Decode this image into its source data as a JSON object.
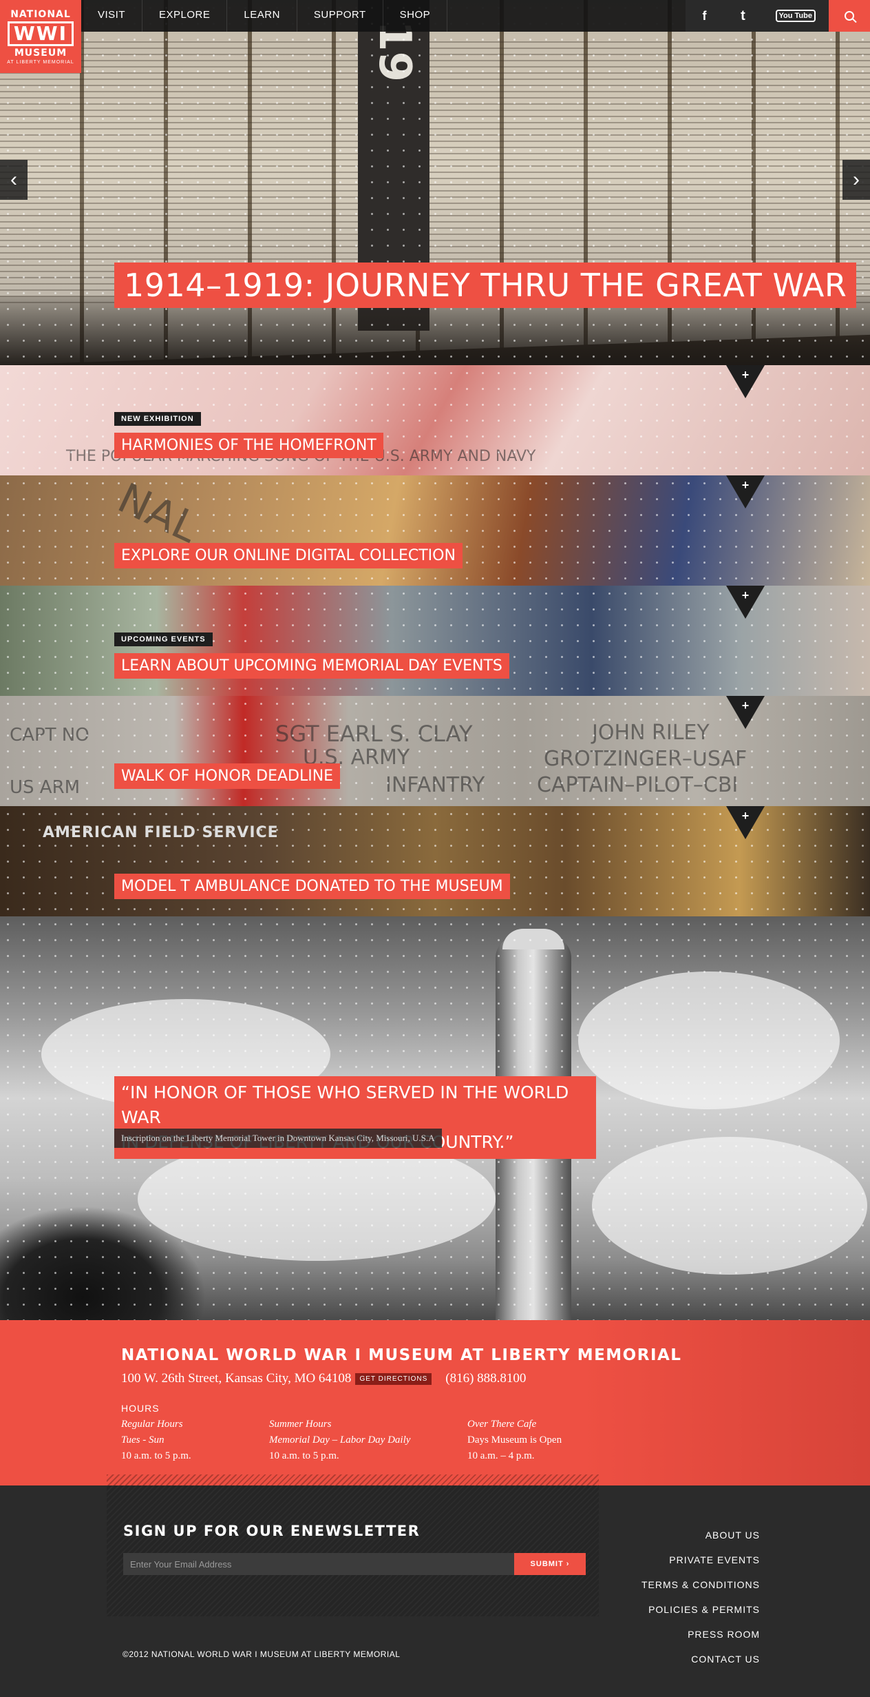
{
  "logo": {
    "line1": "NATIONAL",
    "line2": "WWI",
    "line3": "MUSEUM",
    "line4": "AT LIBERTY MEMORIAL"
  },
  "nav": {
    "items": [
      "VISIT",
      "EXPLORE",
      "LEARN",
      "SUPPORT",
      "SHOP"
    ]
  },
  "social": {
    "facebook": "f",
    "twitter": "t",
    "youtube": "You Tube"
  },
  "icons": {
    "search": "search-icon",
    "facebook": "facebook-icon",
    "twitter": "twitter-icon",
    "youtube": "youtube-icon",
    "prev": "chevron-left-icon",
    "next": "chevron-right-icon",
    "expand": "plus-icon"
  },
  "hero": {
    "title": "1914–1919: JOURNEY THRU THE GREAT WAR",
    "year_text": "19",
    "prev_arrow": "‹",
    "next_arrow": "›"
  },
  "features": [
    {
      "tag": "NEW EXHIBITION",
      "label": "HARMONIES OF THE HOMEFRONT"
    },
    {
      "tag": "",
      "label": "EXPLORE OUR ONLINE DIGITAL COLLECTION"
    },
    {
      "tag": "UPCOMING EVENTS",
      "label": "LEARN ABOUT UPCOMING MEMORIAL DAY EVENTS"
    },
    {
      "tag": "",
      "label": "WALK OF HONOR DEADLINE"
    },
    {
      "tag": "",
      "label": "MODEL T AMBULANCE DONATED TO THE MUSEUM"
    }
  ],
  "feature_art": {
    "s1": "THE POPULAR MARCHING SONG OF THE U.S. ARMY AND NAVY",
    "s2": "NAL",
    "s4a": "CAPT NO",
    "s4b": "SGT EARL S. CLAY",
    "s4c": "U.S. ARMY",
    "s4d": "INFANTRY",
    "s4e": "JOHN RILEY",
    "s4f": "GROTZINGER–USAF",
    "s4g": "CAPTAIN–PILOT–CBI",
    "s4h": "US ARM",
    "s5": "AMERICAN FIELD SERVICE"
  },
  "toggle_symbol": "+",
  "quote": {
    "text_line1": "“IN HONOR OF THOSE WHO SERVED IN THE WORLD WAR",
    "text_line2": "IN DEFENSE OF LIBERTY AND OUR COUNTRY.”",
    "cite": "Inscription on the Liberty Memorial Tower in Downtown Kansas City, Missouri, U.S.A"
  },
  "info": {
    "name": "NATIONAL WORLD WAR I MUSEUM AT LIBERTY MEMORIAL",
    "address": "100 W. 26th Street, Kansas City, MO 64108",
    "directions": "GET DIRECTIONS",
    "phone": "(816) 888.8100",
    "hours_heading": "HOURS",
    "columns": [
      {
        "title": "Regular Hours",
        "sub": "Tues - Sun",
        "time": "10 a.m. to 5 p.m."
      },
      {
        "title": "Summer Hours",
        "sub": "Memorial Day – Labor Day Daily",
        "time": "10 a.m. to 5 p.m."
      },
      {
        "title": "Over There Cafe",
        "sub": "Days Museum is Open",
        "time": "10 a.m. – 4 p.m."
      }
    ]
  },
  "newsletter": {
    "heading": "SIGN UP FOR OUR ENEWSLETTER",
    "placeholder": "Enter Your Email Address",
    "submit": "SUBMIT ›"
  },
  "footer_links": [
    "ABOUT US",
    "PRIVATE EVENTS",
    "TERMS & CONDITIONS",
    "POLICIES & PERMITS",
    "PRESS ROOM",
    "CONTACT US"
  ],
  "copyright": "©2012 NATIONAL WORLD WAR I MUSEUM AT LIBERTY MEMORIAL",
  "colors": {
    "accent": "#ee5043",
    "dark": "#1e1e1e",
    "footer": "#2b2b2b"
  }
}
